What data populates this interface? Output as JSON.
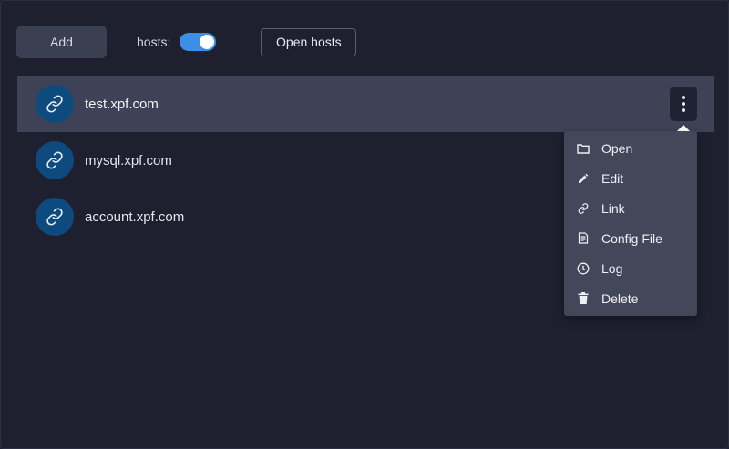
{
  "toolbar": {
    "add_label": "Add",
    "hosts_label": "hosts:",
    "hosts_toggle_on": true,
    "open_hosts_label": "Open hosts"
  },
  "hosts": [
    {
      "name": "test.xpf.com",
      "icon": "link-icon",
      "selected": true
    },
    {
      "name": "mysql.xpf.com",
      "icon": "link-icon",
      "selected": false
    },
    {
      "name": "account.xpf.com",
      "icon": "link-icon",
      "selected": false
    }
  ],
  "context_menu": {
    "items": [
      {
        "label": "Open",
        "icon": "folder-icon"
      },
      {
        "label": "Edit",
        "icon": "pencil-icon"
      },
      {
        "label": "Link",
        "icon": "link-icon"
      },
      {
        "label": "Config File",
        "icon": "config-file-icon"
      },
      {
        "label": "Log",
        "icon": "clock-icon"
      },
      {
        "label": "Delete",
        "icon": "trash-icon"
      }
    ]
  },
  "colors": {
    "background": "#1e2030",
    "selected_row": "#3e4256",
    "avatar": "#0d4a7e",
    "toggle_accent": "#3d8fe6",
    "menu_bg": "#43475a"
  }
}
